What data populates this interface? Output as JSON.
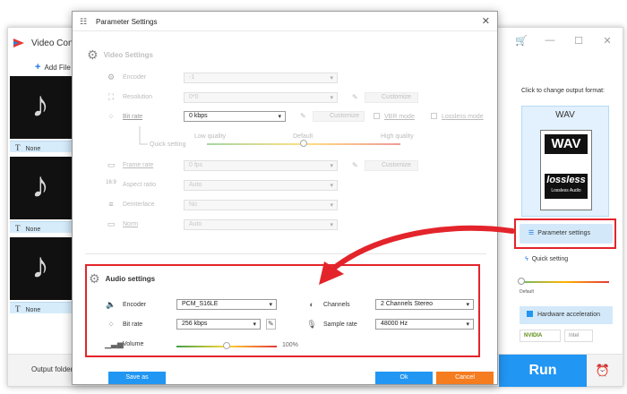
{
  "app": {
    "title": "Video Conv",
    "add_files": "Add File",
    "items": [
      {
        "subtitle": "None"
      },
      {
        "subtitle": "None"
      },
      {
        "subtitle": "None"
      }
    ],
    "output_folder_label": "Output folder:",
    "run_label": "Run"
  },
  "right_panel": {
    "caption": "Click to change output format:",
    "format_name": "WAV",
    "format_badge": "WAV",
    "format_badge_2": "lossless",
    "format_badge_sub": "Lossless Audio",
    "parameter_settings": "Parameter settings",
    "quick_setting": "Quick setting",
    "default_label": "Default",
    "hardware_accel": "Hardware acceleration",
    "vendors": [
      "NVIDIA",
      "Intel"
    ],
    "quality_fraction": 0.0
  },
  "dialog": {
    "title": "Parameter Settings",
    "video": {
      "heading": "Video Settings",
      "encoder_label": "Encoder",
      "encoder_value": "-1",
      "resolution_label": "Resolution",
      "resolution_value": "0*0",
      "customize": "Customize",
      "bitrate_label": "Bit rate",
      "bitrate_value": "0 kbps",
      "vbr_mode": "VBR mode",
      "lossless_mode": "Lossless mode",
      "quick_setting": "Quick setting",
      "low_quality": "Low quality",
      "default_quality": "Default",
      "high_quality": "High quality",
      "quality_fraction": 0.5,
      "framerate_label": "Frame rate",
      "framerate_value": "0 fps",
      "aspect_label": "Aspect ratio",
      "aspect_value": "Auto",
      "deinterlace_label": "Deinterlace",
      "deinterlace_value": "No",
      "norm_label": "Norm",
      "norm_value": "Auto"
    },
    "audio": {
      "heading": "Audio settings",
      "encoder_label": "Encoder",
      "encoder_value": "PCM_S16LE",
      "channels_label": "Channels",
      "channels_value": "2 Channels Stereo",
      "bitrate_label": "Bit rate",
      "bitrate_value": "256 kbps",
      "samplerate_label": "Sample rate",
      "samplerate_value": "48000 Hz",
      "volume_label": "Volume",
      "volume_value": "100%",
      "volume_fraction": 0.5
    },
    "save_as": "Save as",
    "ok": "Ok",
    "cancel": "Cancel"
  },
  "colors": {
    "accent_blue": "#2196f3",
    "cancel_orange": "#f57c1f",
    "highlight_red": "#e3242b"
  }
}
